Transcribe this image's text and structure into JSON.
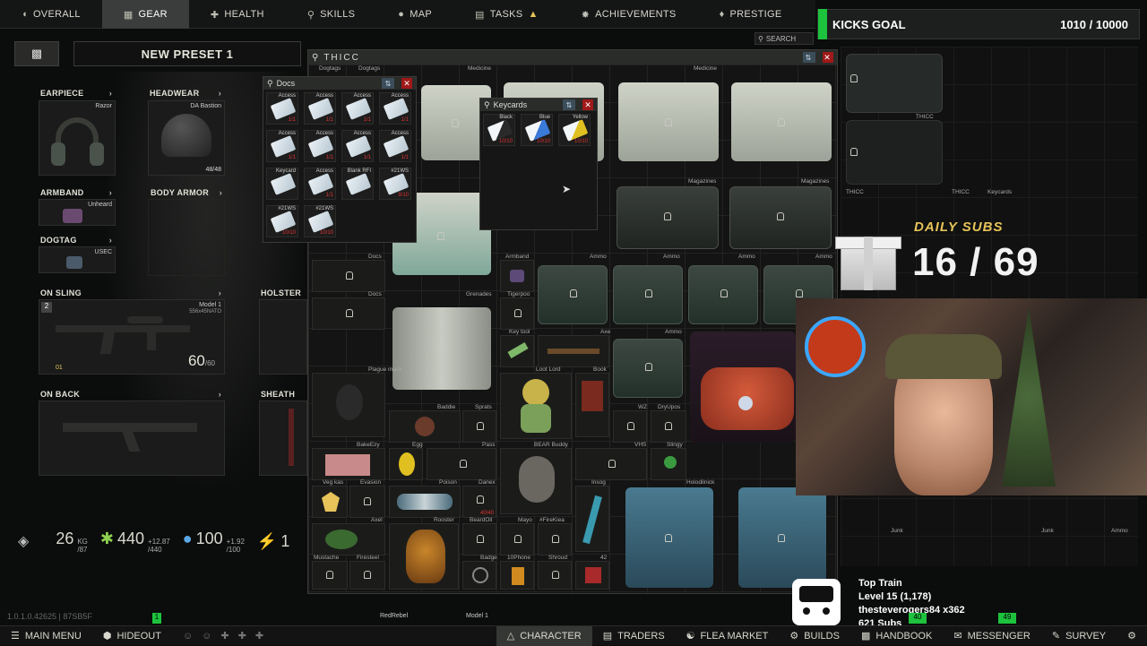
{
  "nav": {
    "tabs": [
      {
        "label": "OVERALL",
        "icon": "person-icon"
      },
      {
        "label": "GEAR",
        "icon": "gear-icon"
      },
      {
        "label": "HEALTH",
        "icon": "health-icon"
      },
      {
        "label": "SKILLS",
        "icon": "skills-icon"
      },
      {
        "label": "MAP",
        "icon": "map-pin-icon"
      },
      {
        "label": "TASKS",
        "icon": "tasks-icon"
      },
      {
        "label": "ACHIEVEMENTS",
        "icon": "achievements-icon"
      },
      {
        "label": "PRESTIGE",
        "icon": "prestige-icon"
      }
    ],
    "search_label": "SEARCH"
  },
  "preset": {
    "name": "NEW PRESET 1"
  },
  "slots": {
    "earpiece": {
      "label": "EARPIECE",
      "item": "Razor"
    },
    "headwear": {
      "label": "HEADWEAR",
      "item": "DA Bastion",
      "count": "48/48"
    },
    "armband": {
      "label": "ARMBAND",
      "item": "Unheard"
    },
    "body_armor": {
      "label": "BODY ARMOR"
    },
    "dogtag": {
      "label": "DOGTAG",
      "item": "USEC"
    },
    "on_sling": {
      "label": "ON SLING",
      "item": "Model 1",
      "ammo_type": "556x45NATO",
      "ammo": "60",
      "ammo_max": "/60",
      "slot_number": "2",
      "badge": "01"
    },
    "holster": {
      "label": "HOLSTER"
    },
    "on_back": {
      "label": "ON BACK"
    },
    "sheath": {
      "label": "SHEATH"
    }
  },
  "stats": {
    "weight": "26",
    "weight_unit": "KG",
    "weight_max": "/87",
    "energy": "440",
    "energy_max": "/440",
    "energy_rate": "+12.87",
    "hydration": "100",
    "hydration_max": "/100",
    "hydration_rate": "+1.92",
    "stamina": "1"
  },
  "thicc": {
    "title": "THICC"
  },
  "docs": {
    "title": "Docs",
    "items": [
      {
        "label": "Access",
        "count": "1/1"
      },
      {
        "label": "Access",
        "count": "1/1"
      },
      {
        "label": "Access",
        "count": "1/1"
      },
      {
        "label": "Access",
        "count": "1/1"
      },
      {
        "label": "Access",
        "count": "1/1"
      },
      {
        "label": "Access",
        "count": "1/1"
      },
      {
        "label": "Access",
        "count": "1/1"
      },
      {
        "label": "Access",
        "count": "1/1"
      },
      {
        "label": "Keycard",
        "count": ""
      },
      {
        "label": "Access",
        "count": "1/1"
      },
      {
        "label": "Blank RFI",
        "count": ""
      },
      {
        "label": "#21WS",
        "count": "9/10"
      },
      {
        "label": "#21WS",
        "count": "10/10"
      },
      {
        "label": "#21WS",
        "count": "10/10"
      }
    ]
  },
  "keycards": {
    "title": "Keycards",
    "items": [
      {
        "label": "Black",
        "count": "10/10"
      },
      {
        "label": "Blue",
        "count": "10/10"
      },
      {
        "label": "Yellow",
        "count": "10/10"
      }
    ]
  },
  "stash_labels": {
    "dogtags1": "Dogtags",
    "dogtags2": "Dogtags",
    "medicine1": "Medicine",
    "medicine2": "Medicine",
    "magazines1": "Magazines",
    "magazines2": "Magazines",
    "docs1": "Docs",
    "docs2": "Docs",
    "grenades": "Grenades",
    "armband": "Armband",
    "ammo1": "Ammo",
    "ammo2": "Ammo",
    "ammo3": "Ammo",
    "ammo4": "Ammo",
    "ammo5": "Ammo",
    "tigerpoo": "Tigerpoo",
    "keytool": "Key tool",
    "axe": "Axe",
    "plague": "Plague mask",
    "lootlord": "Loot Lord",
    "book": "Book",
    "baddie": "Baddie",
    "sprats": "Sprats",
    "wz": "WZ",
    "dryupos": "DryUpos",
    "bakeezy": "BakeEzy",
    "egg": "Egg",
    "pass": "Pass",
    "bearbuddy": "BEAR Buddy",
    "vhs": "VHS",
    "slingy": "Slingy",
    "vegkas": "Veg kas",
    "evasion": "Evasion",
    "poison": "Poison",
    "danex": "Danex",
    "insog": "Insog",
    "holodilnick": "Holodilnick",
    "axel": "Axel",
    "rooster": "Rooster",
    "beardoil": "BeardOil",
    "mayo": "Mayo",
    "firekiea": "#FireKiea",
    "mustache": "Mustache",
    "firesteel": "Firesteel",
    "badge": "Badge",
    "tophone": "10Phone",
    "shroud": "Shroud",
    "r42": "42",
    "thicc_r1": "THICC",
    "thicc_r2": "THICC",
    "thicc_r3": "THICC",
    "keycards_r": "Keycards",
    "junk1": "Junk",
    "junk2": "Junk",
    "ammo_r": "Ammo",
    "count_4040": "40/40"
  },
  "overlay": {
    "kicks_label": "KICKS GOAL",
    "kicks_value": "1010 / 10000",
    "daily_subs_label": "DAILY SUBS",
    "daily_subs_value": "16 / 69",
    "top_train_title": "Top Train",
    "top_train_level": "Level 15 (1,178)",
    "top_train_user": "thesteverogers84 x362",
    "top_train_subs": "621 Subs",
    "num_40": "40",
    "num_49": "49",
    "num_1": "1"
  },
  "version": "1.0.1.0.42625 | 87SB5F",
  "hotbar": {
    "item1": "RedRebel",
    "item2": "Model 1"
  },
  "bottom": {
    "tabs": [
      {
        "label": "MAIN MENU",
        "icon": "menu-icon"
      },
      {
        "label": "HIDEOUT",
        "icon": "hideout-icon"
      },
      {
        "label": "CHARACTER",
        "icon": "character-icon"
      },
      {
        "label": "TRADERS",
        "icon": "traders-icon"
      },
      {
        "label": "FLEA MARKET",
        "icon": "flea-market-icon"
      },
      {
        "label": "BUILDS",
        "icon": "builds-icon"
      },
      {
        "label": "HANDBOOK",
        "icon": "handbook-icon"
      },
      {
        "label": "MESSENGER",
        "icon": "messenger-icon"
      },
      {
        "label": "SURVEY",
        "icon": "survey-icon"
      }
    ]
  },
  "colors": {
    "accent_green": "#1dc23d",
    "close_red": "#a01818",
    "gold": "#e7c35a"
  }
}
